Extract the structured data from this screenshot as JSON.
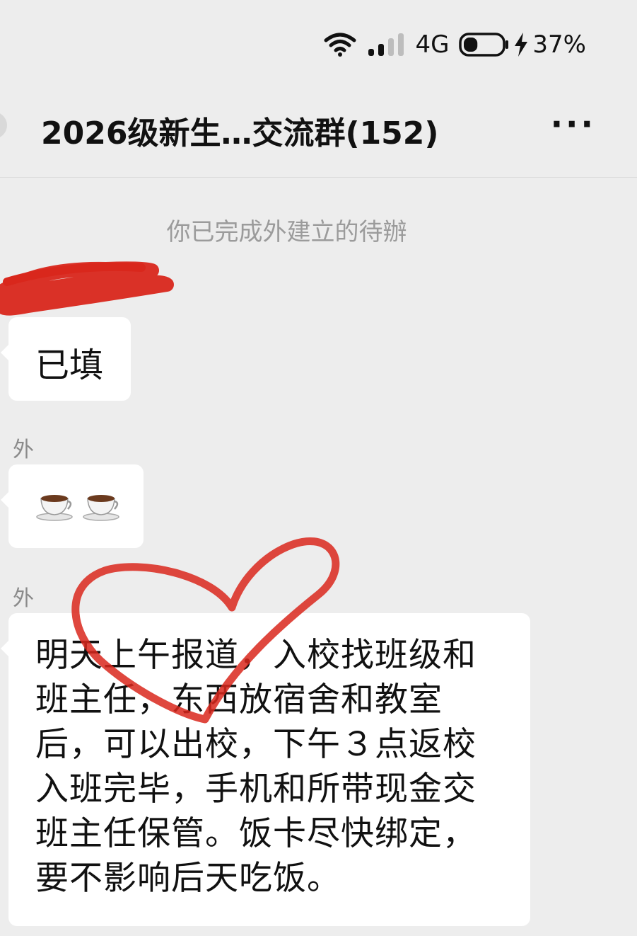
{
  "status_bar": {
    "network": "4G",
    "battery_percent": "37%",
    "battery_level": 0.37
  },
  "header": {
    "title": "2026级新生…交流群(152)",
    "more_label": "···"
  },
  "system_message": "你已完成外建立的待辦",
  "messages": [
    {
      "sender": "",
      "text": "已填"
    },
    {
      "sender": "外",
      "text": ""
    },
    {
      "sender": "外",
      "text": "明天上午报道，入校找班级和班主任，东西放宿舍和教室后，可以出校，下午３点返校入班完毕，手机和所带现金交班主任保管。饭卡尽快绑定，要不影响后天吃饭。"
    }
  ],
  "icons": {
    "wifi": "wifi-icon",
    "signal": "signal-icon",
    "battery": "battery-icon",
    "charging": "charging-bolt-icon",
    "coffee": "coffee-cup-icon"
  },
  "colors": {
    "background": "#ededed",
    "bubble": "#ffffff",
    "annotation_red": "#d9271c",
    "system_text": "#9b9b9b"
  }
}
